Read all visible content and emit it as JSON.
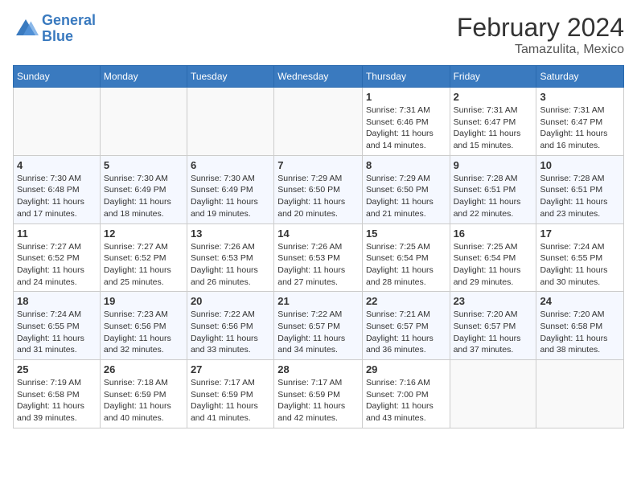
{
  "header": {
    "logo_line1": "General",
    "logo_line2": "Blue",
    "month_year": "February 2024",
    "location": "Tamazulita, Mexico"
  },
  "weekdays": [
    "Sunday",
    "Monday",
    "Tuesday",
    "Wednesday",
    "Thursday",
    "Friday",
    "Saturday"
  ],
  "weeks": [
    [
      {
        "day": "",
        "info": ""
      },
      {
        "day": "",
        "info": ""
      },
      {
        "day": "",
        "info": ""
      },
      {
        "day": "",
        "info": ""
      },
      {
        "day": "1",
        "info": "Sunrise: 7:31 AM\nSunset: 6:46 PM\nDaylight: 11 hours and 14 minutes."
      },
      {
        "day": "2",
        "info": "Sunrise: 7:31 AM\nSunset: 6:47 PM\nDaylight: 11 hours and 15 minutes."
      },
      {
        "day": "3",
        "info": "Sunrise: 7:31 AM\nSunset: 6:47 PM\nDaylight: 11 hours and 16 minutes."
      }
    ],
    [
      {
        "day": "4",
        "info": "Sunrise: 7:30 AM\nSunset: 6:48 PM\nDaylight: 11 hours and 17 minutes."
      },
      {
        "day": "5",
        "info": "Sunrise: 7:30 AM\nSunset: 6:49 PM\nDaylight: 11 hours and 18 minutes."
      },
      {
        "day": "6",
        "info": "Sunrise: 7:30 AM\nSunset: 6:49 PM\nDaylight: 11 hours and 19 minutes."
      },
      {
        "day": "7",
        "info": "Sunrise: 7:29 AM\nSunset: 6:50 PM\nDaylight: 11 hours and 20 minutes."
      },
      {
        "day": "8",
        "info": "Sunrise: 7:29 AM\nSunset: 6:50 PM\nDaylight: 11 hours and 21 minutes."
      },
      {
        "day": "9",
        "info": "Sunrise: 7:28 AM\nSunset: 6:51 PM\nDaylight: 11 hours and 22 minutes."
      },
      {
        "day": "10",
        "info": "Sunrise: 7:28 AM\nSunset: 6:51 PM\nDaylight: 11 hours and 23 minutes."
      }
    ],
    [
      {
        "day": "11",
        "info": "Sunrise: 7:27 AM\nSunset: 6:52 PM\nDaylight: 11 hours and 24 minutes."
      },
      {
        "day": "12",
        "info": "Sunrise: 7:27 AM\nSunset: 6:52 PM\nDaylight: 11 hours and 25 minutes."
      },
      {
        "day": "13",
        "info": "Sunrise: 7:26 AM\nSunset: 6:53 PM\nDaylight: 11 hours and 26 minutes."
      },
      {
        "day": "14",
        "info": "Sunrise: 7:26 AM\nSunset: 6:53 PM\nDaylight: 11 hours and 27 minutes."
      },
      {
        "day": "15",
        "info": "Sunrise: 7:25 AM\nSunset: 6:54 PM\nDaylight: 11 hours and 28 minutes."
      },
      {
        "day": "16",
        "info": "Sunrise: 7:25 AM\nSunset: 6:54 PM\nDaylight: 11 hours and 29 minutes."
      },
      {
        "day": "17",
        "info": "Sunrise: 7:24 AM\nSunset: 6:55 PM\nDaylight: 11 hours and 30 minutes."
      }
    ],
    [
      {
        "day": "18",
        "info": "Sunrise: 7:24 AM\nSunset: 6:55 PM\nDaylight: 11 hours and 31 minutes."
      },
      {
        "day": "19",
        "info": "Sunrise: 7:23 AM\nSunset: 6:56 PM\nDaylight: 11 hours and 32 minutes."
      },
      {
        "day": "20",
        "info": "Sunrise: 7:22 AM\nSunset: 6:56 PM\nDaylight: 11 hours and 33 minutes."
      },
      {
        "day": "21",
        "info": "Sunrise: 7:22 AM\nSunset: 6:57 PM\nDaylight: 11 hours and 34 minutes."
      },
      {
        "day": "22",
        "info": "Sunrise: 7:21 AM\nSunset: 6:57 PM\nDaylight: 11 hours and 36 minutes."
      },
      {
        "day": "23",
        "info": "Sunrise: 7:20 AM\nSunset: 6:57 PM\nDaylight: 11 hours and 37 minutes."
      },
      {
        "day": "24",
        "info": "Sunrise: 7:20 AM\nSunset: 6:58 PM\nDaylight: 11 hours and 38 minutes."
      }
    ],
    [
      {
        "day": "25",
        "info": "Sunrise: 7:19 AM\nSunset: 6:58 PM\nDaylight: 11 hours and 39 minutes."
      },
      {
        "day": "26",
        "info": "Sunrise: 7:18 AM\nSunset: 6:59 PM\nDaylight: 11 hours and 40 minutes."
      },
      {
        "day": "27",
        "info": "Sunrise: 7:17 AM\nSunset: 6:59 PM\nDaylight: 11 hours and 41 minutes."
      },
      {
        "day": "28",
        "info": "Sunrise: 7:17 AM\nSunset: 6:59 PM\nDaylight: 11 hours and 42 minutes."
      },
      {
        "day": "29",
        "info": "Sunrise: 7:16 AM\nSunset: 7:00 PM\nDaylight: 11 hours and 43 minutes."
      },
      {
        "day": "",
        "info": ""
      },
      {
        "day": "",
        "info": ""
      }
    ]
  ]
}
